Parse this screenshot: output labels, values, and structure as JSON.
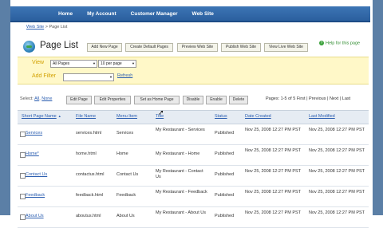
{
  "nav": {
    "home": "Home",
    "account": "My Account",
    "customer_manager": "Customer Manager",
    "web_site": "Web Site"
  },
  "breadcrumb": {
    "parent": "Web Site",
    "separator": ">",
    "current": "Page List"
  },
  "page_title": "Page List",
  "toolbar": {
    "add_new_page": "Add New Page",
    "create_default_pages": "Create Default Pages",
    "preview_web_site": "Preview Web Site",
    "publish_web_site": "Publish Web Site",
    "view_live_web_site": "View Live Web Site"
  },
  "help": {
    "icon": "?",
    "label": "Help for this page"
  },
  "filter": {
    "view_label": "View",
    "view_value": "All Pages",
    "per_page_value": "10 per page",
    "add_filter_label": "Add Filter",
    "add_filter_value": "",
    "refresh": "Refresh"
  },
  "actions": {
    "select_label": "Select:",
    "select_all": "All",
    "select_none": "None",
    "edit_page": "Edit Page",
    "edit_properties": "Edit Properties",
    "set_home": "Set as Home Page",
    "disable": "Disable",
    "enable": "Enable",
    "delete": "Delete"
  },
  "pager": {
    "summary": "Pages: 1-5 of 5",
    "first": "First",
    "previous": "Previous",
    "next": "Next",
    "last": "Last",
    "sep": "|"
  },
  "table": {
    "headers": {
      "short_name": "Short Page Name",
      "file_name": "File Name",
      "menu_item": "Menu Item",
      "title": "Title",
      "status": "Status",
      "date_created": "Date Created",
      "last_modified": "Last Modified"
    },
    "rows": [
      {
        "short_name": "Services",
        "file_name": "services.html",
        "menu_item": "Services",
        "title": "My Restaurant - Services",
        "status": "Published",
        "date_created": "Nov 25, 2008 12:27 PM PST",
        "last_modified": "Nov 25, 2008 12:27 PM PST"
      },
      {
        "short_name": "Home*",
        "file_name": "home.html",
        "menu_item": "Home",
        "title": "My Restaurant - Home",
        "status": "Published",
        "date_created": "Nov 25, 2008 12:27 PM PST",
        "last_modified": "Nov 25, 2008 12:27 PM PST"
      },
      {
        "short_name": "Contact Us",
        "file_name": "contactus.html",
        "menu_item": "Contact Us",
        "title": "My Restaurant - Contact Us",
        "status": "Published",
        "date_created": "Nov 25, 2008 12:27 PM PST",
        "last_modified": "Nov 25, 2008 12:27 PM PST"
      },
      {
        "short_name": "Feedback",
        "file_name": "feedback.html",
        "menu_item": "Feedback",
        "title": "My Restaurant - Feedback",
        "status": "Published",
        "date_created": "Nov 25, 2008 12:27 PM PST",
        "last_modified": "Nov 25, 2008 12:27 PM PST"
      },
      {
        "short_name": "About Us",
        "file_name": "aboutus.html",
        "menu_item": "About Us",
        "title": "My Restaurant - About Us",
        "status": "Published",
        "date_created": "Nov 25, 2008 12:27 PM PST",
        "last_modified": "Nov 25, 2008 12:27 PM PST"
      }
    ]
  },
  "colors": {
    "nav_bar": "#2b5f9e",
    "filter_bg": "#fff8c8",
    "filter_label": "#d2a000",
    "link": "#2a5db0",
    "frame": "#5b7fa6"
  }
}
